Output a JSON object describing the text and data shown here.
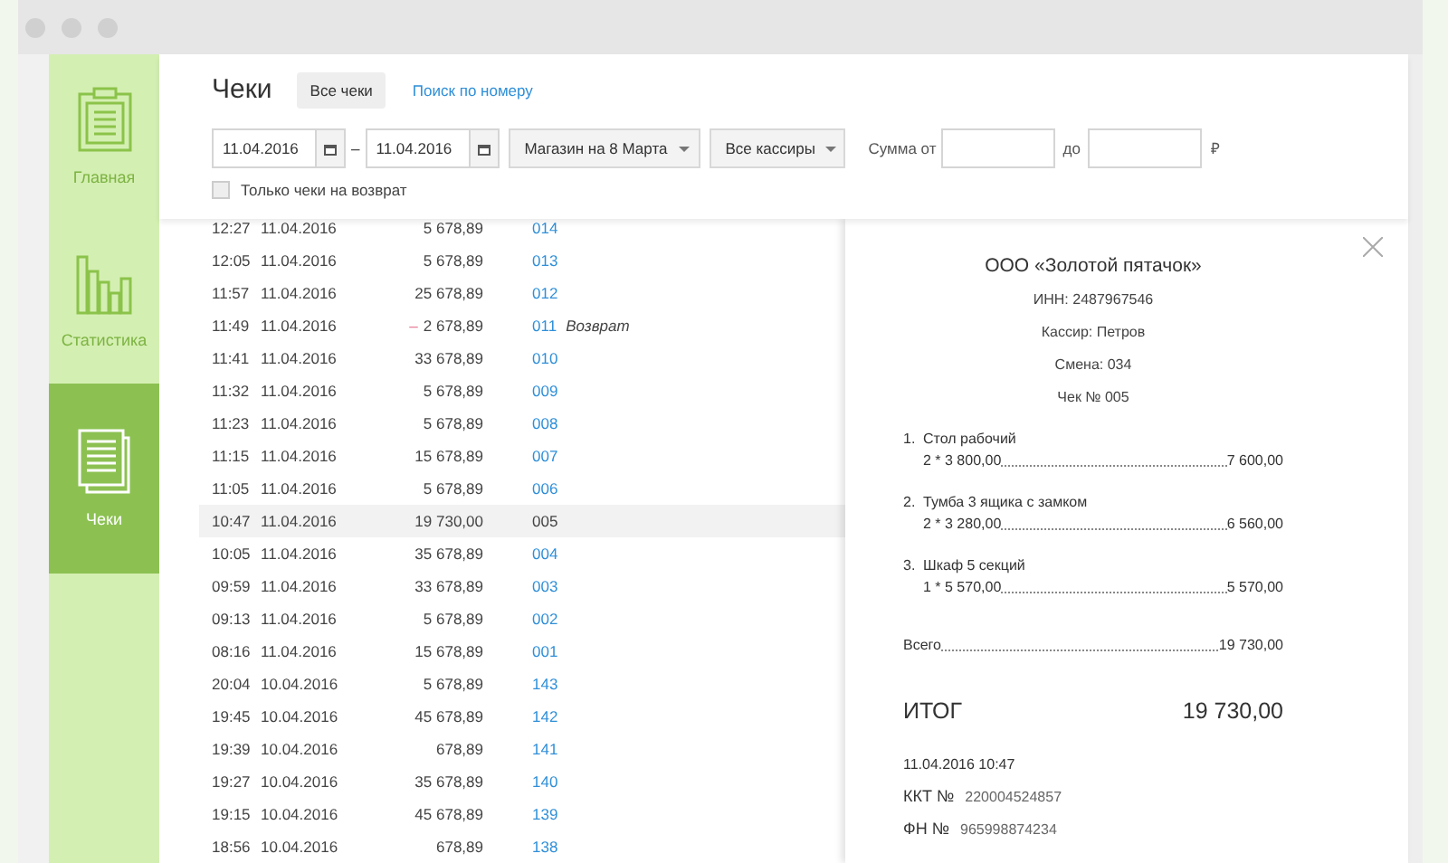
{
  "sidebar": {
    "items": [
      {
        "label": "Главная",
        "kind": "clipboard",
        "selected": false
      },
      {
        "label": "Статистика",
        "kind": "chart",
        "selected": false
      },
      {
        "label": "Чеки",
        "kind": "document",
        "selected": true
      }
    ]
  },
  "header": {
    "title": "Чеки",
    "tabs": [
      {
        "label": "Все чеки",
        "selected": true
      },
      {
        "label": "Поиск по номеру",
        "selected": false
      }
    ]
  },
  "filters": {
    "date_from": "11.04.2016",
    "date_separator": "–",
    "date_to": "11.04.2016",
    "store": "Магазин на 8 Марта",
    "cashier": "Все кассиры",
    "sum_from_label": "Сумма от",
    "sum_to_label": "до",
    "currency": "₽",
    "refund_only": {
      "label": "Только чеки на возврат",
      "checked": false
    }
  },
  "rows": [
    {
      "time": "12:27",
      "date": "11.04.2016",
      "amount": "5 678,89",
      "number": "014",
      "selected": false
    },
    {
      "time": "12:05",
      "date": "11.04.2016",
      "amount": "5 678,89",
      "number": "013",
      "selected": false
    },
    {
      "time": "11:57",
      "date": "11.04.2016",
      "amount": "25 678,89",
      "number": "012",
      "selected": false
    },
    {
      "time": "11:49",
      "date": "11.04.2016",
      "sign": "–",
      "amount": "2 678,89",
      "number": "011",
      "note": "Возврат",
      "selected": false
    },
    {
      "time": "11:41",
      "date": "11.04.2016",
      "amount": "33 678,89",
      "number": "010",
      "selected": false
    },
    {
      "time": "11:32",
      "date": "11.04.2016",
      "amount": "5 678,89",
      "number": "009",
      "selected": false
    },
    {
      "time": "11:23",
      "date": "11.04.2016",
      "amount": "5 678,89",
      "number": "008",
      "selected": false
    },
    {
      "time": "11:15",
      "date": "11.04.2016",
      "amount": "15 678,89",
      "number": "007",
      "selected": false
    },
    {
      "time": "11:05",
      "date": "11.04.2016",
      "amount": "5 678,89",
      "number": "006",
      "selected": false
    },
    {
      "time": "10:47",
      "date": "11.04.2016",
      "amount": "19 730,00",
      "number": "005",
      "selected": true
    },
    {
      "time": "10:05",
      "date": "11.04.2016",
      "amount": "35 678,89",
      "number": "004",
      "selected": false
    },
    {
      "time": "09:59",
      "date": "11.04.2016",
      "amount": "33 678,89",
      "number": "003",
      "selected": false
    },
    {
      "time": "09:13",
      "date": "11.04.2016",
      "amount": "5 678,89",
      "number": "002",
      "selected": false
    },
    {
      "time": "08:16",
      "date": "11.04.2016",
      "amount": "15 678,89",
      "number": "001",
      "selected": false
    },
    {
      "time": "20:04",
      "date": "10.04.2016",
      "amount": "5 678,89",
      "number": "143",
      "selected": false
    },
    {
      "time": "19:45",
      "date": "10.04.2016",
      "amount": "45 678,89",
      "number": "142",
      "selected": false
    },
    {
      "time": "19:39",
      "date": "10.04.2016",
      "amount": "678,89",
      "number": "141",
      "selected": false
    },
    {
      "time": "19:27",
      "date": "10.04.2016",
      "amount": "35 678,89",
      "number": "140",
      "selected": false
    },
    {
      "time": "19:15",
      "date": "10.04.2016",
      "amount": "45 678,89",
      "number": "139",
      "selected": false
    },
    {
      "time": "18:56",
      "date": "10.04.2016",
      "amount": "678,89",
      "number": "138",
      "selected": false
    }
  ],
  "receipt": {
    "company": "ООО «Золотой пятачок»",
    "inn": "ИНН: 2487967546",
    "cashier": "Кассир: Петров",
    "shift": "Смена: 034",
    "number": "Чек № 005",
    "items": [
      {
        "index": "1.",
        "name": "Стол рабочий",
        "calc": "2 * 3 800,00",
        "sum": "7 600,00"
      },
      {
        "index": "2.",
        "name": "Тумба 3 ящика с замком",
        "calc": "2 * 3 280,00",
        "sum": "6 560,00"
      },
      {
        "index": "3.",
        "name": "Шкаф 5 секций",
        "calc": "1 * 5 570,00",
        "sum": "5 570,00"
      }
    ],
    "subtotal_label": "Всего",
    "subtotal": "19 730,00",
    "total_label": "ИТОГ",
    "total": "19 730,00",
    "datetime": "11.04.2016 10:47",
    "fields": [
      {
        "label": "ККТ №",
        "value": "220004524857"
      },
      {
        "label": "ФН №",
        "value": "965998874234"
      }
    ]
  }
}
